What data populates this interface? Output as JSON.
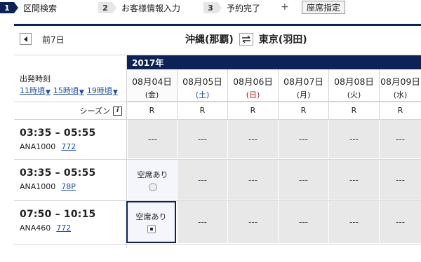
{
  "steps": [
    {
      "num": "1",
      "label": "区間検索",
      "active": true
    },
    {
      "num": "2",
      "label": "お客様情報入力",
      "active": false
    },
    {
      "num": "3",
      "label": "予約完了",
      "active": false
    }
  ],
  "step_plus": "+",
  "seat_button": "座席指定",
  "nav": {
    "prev_label": "前7日"
  },
  "route": {
    "from": "沖縄(那覇)",
    "to": "東京(羽田)",
    "swap_icon": "swap-icon"
  },
  "year": "2017年",
  "departure": {
    "heading": "出発時刻",
    "links": [
      "11時頃",
      "15時頃",
      "19時頃"
    ]
  },
  "season_label": "シーズン",
  "dates": [
    {
      "date": "08月04日",
      "weekday": "(金)",
      "season": "R",
      "type": "weekday"
    },
    {
      "date": "08月05日",
      "weekday": "(土)",
      "season": "R",
      "type": "sat"
    },
    {
      "date": "08月06日",
      "weekday": "(日)",
      "season": "R",
      "type": "sun"
    },
    {
      "date": "08月07日",
      "weekday": "(月)",
      "season": "R",
      "type": "weekday"
    },
    {
      "date": "08月08日",
      "weekday": "(火)",
      "season": "R",
      "type": "weekday"
    },
    {
      "date": "08月09日",
      "weekday": "(水)",
      "season": "R",
      "type": "weekday"
    }
  ],
  "flights": [
    {
      "time": "03:35 – 05:55",
      "flight": "ANA1000",
      "code": "772",
      "cells": [
        "---",
        "---",
        "---",
        "---",
        "---",
        "---"
      ]
    },
    {
      "time": "03:35 – 05:55",
      "flight": "ANA1000",
      "code": "78P",
      "cells": [
        "空席あり",
        "---",
        "---",
        "---",
        "---",
        "---"
      ]
    },
    {
      "time": "07:50 – 10:15",
      "flight": "ANA460",
      "code": "772",
      "cells": [
        "空席あり",
        "---",
        "---",
        "---",
        "---",
        "---"
      ]
    }
  ],
  "colors": {
    "brand_navy": "#0d2357",
    "link_blue": "#1b4fa8",
    "sunday_red": "#b3121f"
  }
}
